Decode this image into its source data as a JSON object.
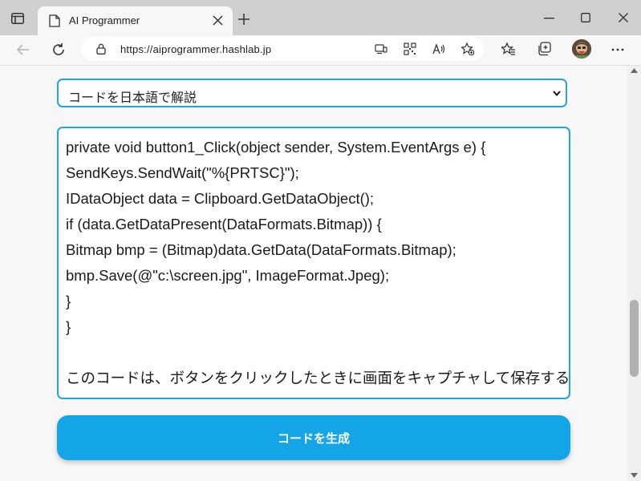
{
  "browser": {
    "tab_title": "AI Programmer",
    "url": "https://aiprogrammer.hashlab.jp"
  },
  "page": {
    "select": {
      "value": "コードを日本語で解説"
    },
    "code_lines": [
      "private void button1_Click(object sender, System.EventArgs e) {",
      "SendKeys.SendWait(\"%{PRTSC}\");",
      "IDataObject data = Clipboard.GetDataObject();",
      "if (data.GetDataPresent(DataFormats.Bitmap)) {",
      "Bitmap bmp = (Bitmap)data.GetData(DataFormats.Bitmap);",
      "bmp.Save(@\"c:\\screen.jpg\", ImageFormat.Jpeg);",
      "}",
      "}",
      "",
      "このコードは、ボタンをクリックしたときに画面をキャプチャして保存するものです。"
    ],
    "generate_button": "コードを生成"
  },
  "icons": {
    "tab_actions": "tab-actions-icon",
    "page": "page-icon",
    "close_tab": "close-icon",
    "new_tab": "plus-icon",
    "minimize": "minimize-icon",
    "maximize": "maximize-icon",
    "close_window": "close-window-icon",
    "back": "back-arrow-icon",
    "refresh": "refresh-icon",
    "lock": "lock-icon",
    "app_available": "app-available-icon",
    "qr": "qr-code-icon",
    "read_aloud": "read-aloud-icon",
    "add_favorite": "add-favorite-icon",
    "favorites": "favorites-icon",
    "collections": "collections-icon",
    "profile": "avatar",
    "more": "more-icon"
  },
  "colors": {
    "accent": "#22a6d6",
    "button": "#14a5e6",
    "tabbar": "#cfcfcf"
  }
}
